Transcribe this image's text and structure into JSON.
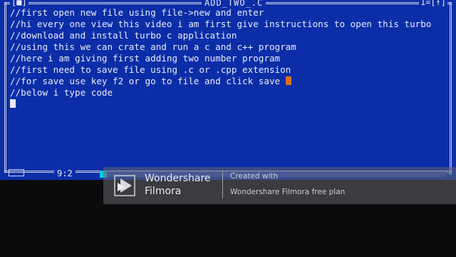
{
  "window": {
    "title": "ADD_TWO_.C",
    "top_left_control": "[■]",
    "top_right_control": "1=[↑]"
  },
  "editor": {
    "lines": [
      "//first open new file using file->new and enter",
      "//hi every one view this video i am first give instructions to open this turbo",
      "//download and install turbo c application",
      "//using this we can crate and run a c and c++ program",
      "//here i am giving first adding two number program",
      "//first need to save file using .c or .cpp extension",
      "//for save use key f2 or go to file and click save ",
      "//below i type code"
    ]
  },
  "status": {
    "position": "9:2"
  },
  "watermark": {
    "brand_line1": "Wondershare",
    "brand_line2": "Filmora",
    "created_with": "Created with",
    "free_plan": "Wondershare Filmora free plan"
  },
  "colors": {
    "editor_bg": "#0b2ea8",
    "text": "#e9ebf6",
    "cursor": "#e07020",
    "scroll_thumb": "#14c8d8"
  }
}
